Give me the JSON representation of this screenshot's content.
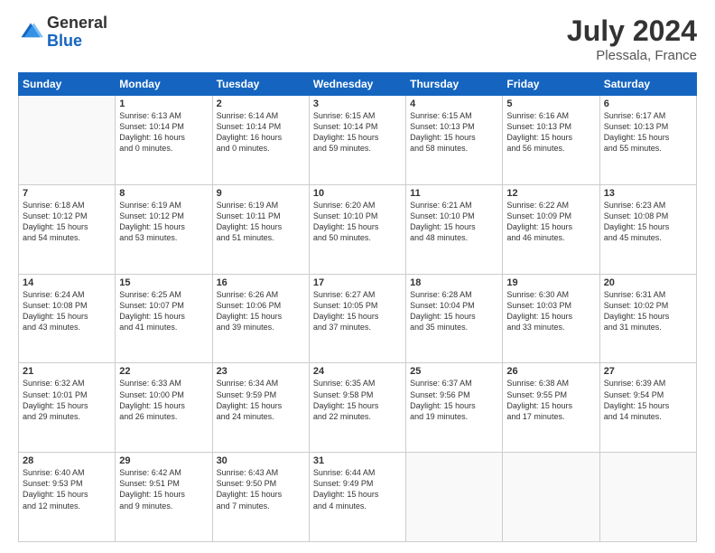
{
  "header": {
    "logo_general": "General",
    "logo_blue": "Blue",
    "month_year": "July 2024",
    "location": "Plessala, France"
  },
  "calendar": {
    "day_headers": [
      "Sunday",
      "Monday",
      "Tuesday",
      "Wednesday",
      "Thursday",
      "Friday",
      "Saturday"
    ],
    "weeks": [
      [
        {
          "day": "",
          "content": ""
        },
        {
          "day": "1",
          "content": "Sunrise: 6:13 AM\nSunset: 10:14 PM\nDaylight: 16 hours\nand 0 minutes."
        },
        {
          "day": "2",
          "content": "Sunrise: 6:14 AM\nSunset: 10:14 PM\nDaylight: 16 hours\nand 0 minutes."
        },
        {
          "day": "3",
          "content": "Sunrise: 6:15 AM\nSunset: 10:14 PM\nDaylight: 15 hours\nand 59 minutes."
        },
        {
          "day": "4",
          "content": "Sunrise: 6:15 AM\nSunset: 10:13 PM\nDaylight: 15 hours\nand 58 minutes."
        },
        {
          "day": "5",
          "content": "Sunrise: 6:16 AM\nSunset: 10:13 PM\nDaylight: 15 hours\nand 56 minutes."
        },
        {
          "day": "6",
          "content": "Sunrise: 6:17 AM\nSunset: 10:13 PM\nDaylight: 15 hours\nand 55 minutes."
        }
      ],
      [
        {
          "day": "7",
          "content": "Sunrise: 6:18 AM\nSunset: 10:12 PM\nDaylight: 15 hours\nand 54 minutes."
        },
        {
          "day": "8",
          "content": "Sunrise: 6:19 AM\nSunset: 10:12 PM\nDaylight: 15 hours\nand 53 minutes."
        },
        {
          "day": "9",
          "content": "Sunrise: 6:19 AM\nSunset: 10:11 PM\nDaylight: 15 hours\nand 51 minutes."
        },
        {
          "day": "10",
          "content": "Sunrise: 6:20 AM\nSunset: 10:10 PM\nDaylight: 15 hours\nand 50 minutes."
        },
        {
          "day": "11",
          "content": "Sunrise: 6:21 AM\nSunset: 10:10 PM\nDaylight: 15 hours\nand 48 minutes."
        },
        {
          "day": "12",
          "content": "Sunrise: 6:22 AM\nSunset: 10:09 PM\nDaylight: 15 hours\nand 46 minutes."
        },
        {
          "day": "13",
          "content": "Sunrise: 6:23 AM\nSunset: 10:08 PM\nDaylight: 15 hours\nand 45 minutes."
        }
      ],
      [
        {
          "day": "14",
          "content": "Sunrise: 6:24 AM\nSunset: 10:08 PM\nDaylight: 15 hours\nand 43 minutes."
        },
        {
          "day": "15",
          "content": "Sunrise: 6:25 AM\nSunset: 10:07 PM\nDaylight: 15 hours\nand 41 minutes."
        },
        {
          "day": "16",
          "content": "Sunrise: 6:26 AM\nSunset: 10:06 PM\nDaylight: 15 hours\nand 39 minutes."
        },
        {
          "day": "17",
          "content": "Sunrise: 6:27 AM\nSunset: 10:05 PM\nDaylight: 15 hours\nand 37 minutes."
        },
        {
          "day": "18",
          "content": "Sunrise: 6:28 AM\nSunset: 10:04 PM\nDaylight: 15 hours\nand 35 minutes."
        },
        {
          "day": "19",
          "content": "Sunrise: 6:30 AM\nSunset: 10:03 PM\nDaylight: 15 hours\nand 33 minutes."
        },
        {
          "day": "20",
          "content": "Sunrise: 6:31 AM\nSunset: 10:02 PM\nDaylight: 15 hours\nand 31 minutes."
        }
      ],
      [
        {
          "day": "21",
          "content": "Sunrise: 6:32 AM\nSunset: 10:01 PM\nDaylight: 15 hours\nand 29 minutes."
        },
        {
          "day": "22",
          "content": "Sunrise: 6:33 AM\nSunset: 10:00 PM\nDaylight: 15 hours\nand 26 minutes."
        },
        {
          "day": "23",
          "content": "Sunrise: 6:34 AM\nSunset: 9:59 PM\nDaylight: 15 hours\nand 24 minutes."
        },
        {
          "day": "24",
          "content": "Sunrise: 6:35 AM\nSunset: 9:58 PM\nDaylight: 15 hours\nand 22 minutes."
        },
        {
          "day": "25",
          "content": "Sunrise: 6:37 AM\nSunset: 9:56 PM\nDaylight: 15 hours\nand 19 minutes."
        },
        {
          "day": "26",
          "content": "Sunrise: 6:38 AM\nSunset: 9:55 PM\nDaylight: 15 hours\nand 17 minutes."
        },
        {
          "day": "27",
          "content": "Sunrise: 6:39 AM\nSunset: 9:54 PM\nDaylight: 15 hours\nand 14 minutes."
        }
      ],
      [
        {
          "day": "28",
          "content": "Sunrise: 6:40 AM\nSunset: 9:53 PM\nDaylight: 15 hours\nand 12 minutes."
        },
        {
          "day": "29",
          "content": "Sunrise: 6:42 AM\nSunset: 9:51 PM\nDaylight: 15 hours\nand 9 minutes."
        },
        {
          "day": "30",
          "content": "Sunrise: 6:43 AM\nSunset: 9:50 PM\nDaylight: 15 hours\nand 7 minutes."
        },
        {
          "day": "31",
          "content": "Sunrise: 6:44 AM\nSunset: 9:49 PM\nDaylight: 15 hours\nand 4 minutes."
        },
        {
          "day": "",
          "content": ""
        },
        {
          "day": "",
          "content": ""
        },
        {
          "day": "",
          "content": ""
        }
      ]
    ]
  }
}
